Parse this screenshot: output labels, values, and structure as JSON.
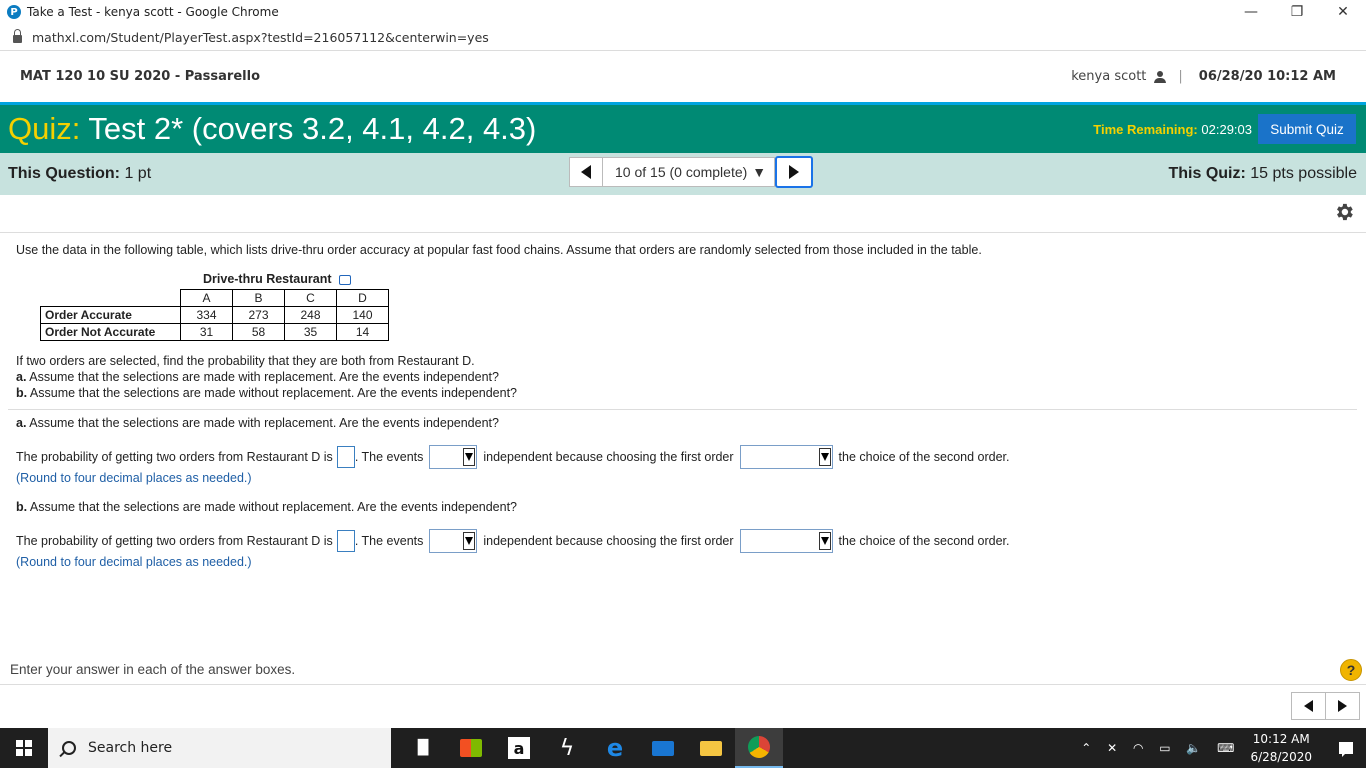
{
  "browser": {
    "window_title": "Take a Test - kenya scott - Google Chrome",
    "favicon_letter": "P",
    "url": "mathxl.com/Student/PlayerTest.aspx?testId=216057112&centerwin=yes",
    "controls": {
      "minimize": "—",
      "restore": "❐",
      "close": "✕"
    }
  },
  "course": {
    "name": "MAT 120 10 SU 2020 - Passarello",
    "user": "kenya scott",
    "separator": "|",
    "datetime": "06/28/20 10:12 AM"
  },
  "quiz": {
    "label": "Quiz:",
    "title": "Test 2* (covers 3.2, 4.1, 4.2, 4.3)",
    "time_label": "Time Remaining:",
    "time_value": "02:29:03",
    "submit_label": "Submit Quiz",
    "colors": {
      "bar": "#008a74",
      "accent": "#f5d000",
      "submit": "#1a73c9"
    }
  },
  "question_bar": {
    "this_question_label": "This Question:",
    "this_question_value": "1 pt",
    "selector": "10 of 15 (0 complete)",
    "this_quiz_label": "This Quiz:",
    "this_quiz_value": "15 pts possible"
  },
  "problem": {
    "intro": "Use the data in the following table, which lists drive-thru order accuracy at popular fast food chains. Assume that orders are randomly selected from those included in the table.",
    "table": {
      "title": "Drive-thru Restaurant",
      "columns": [
        "A",
        "B",
        "C",
        "D"
      ],
      "rows": [
        {
          "label": "Order Accurate",
          "values": [
            "334",
            "273",
            "248",
            "140"
          ]
        },
        {
          "label": "Order Not Accurate",
          "values": [
            "31",
            "58",
            "35",
            "14"
          ]
        }
      ]
    },
    "question": "If two orders are selected, find the probability that they are both from Restaurant D.",
    "item_a_prefix": "a.",
    "item_a": "Assume that the selections are made with replacement. Are the events independent?",
    "item_b_prefix": "b.",
    "item_b": "Assume that the selections are made without replacement. Are the events independent?"
  },
  "answers": {
    "part_a": {
      "prefix": "a.",
      "heading": "Assume that the selections are made with replacement. Are the events independent?",
      "prob_text": "The probability of getting two orders from Restaurant D is",
      "events_text": ". The events",
      "independent_text": "independent because choosing the first order",
      "second_text": "the choice of the second order.",
      "round_note": "(Round to four decimal places as needed.)",
      "prob_value": "",
      "events_value": "",
      "choice_value": ""
    },
    "part_b": {
      "prefix": "b.",
      "heading": "Assume that the selections are made without replacement. Are the events independent?",
      "prob_text": "The probability of getting two orders from Restaurant D is",
      "events_text": ". The events",
      "independent_text": "independent because choosing the first order",
      "second_text": "the choice of the second order.",
      "round_note": "(Round to four decimal places as needed.)",
      "prob_value": "",
      "events_value": "",
      "choice_value": ""
    }
  },
  "footer": {
    "instruction": "Enter your answer in each of the answer boxes.",
    "help_label": "?"
  },
  "taskbar": {
    "search_placeholder": "Search here",
    "icons": [
      "task-view-icon",
      "store-icon",
      "amazon-icon",
      "winamp-icon",
      "edge-icon",
      "mail-icon",
      "file-explorer-icon",
      "chrome-icon"
    ],
    "amazon_letter": "a",
    "time": "10:12 AM",
    "date": "6/28/2020"
  }
}
